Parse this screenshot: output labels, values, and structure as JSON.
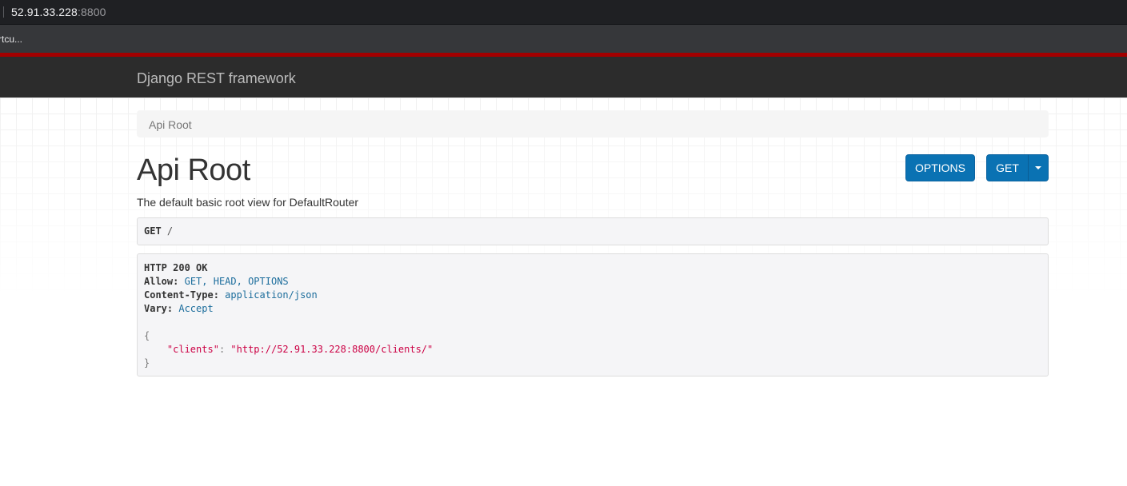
{
  "browser": {
    "url_host": "52.91.33.228",
    "url_port": ":8800",
    "bookmark_label": "rtcu..."
  },
  "navbar": {
    "brand": "Django REST framework"
  },
  "breadcrumb": {
    "items": [
      "Api Root"
    ]
  },
  "page": {
    "title": "Api Root",
    "description": "The default basic root view for DefaultRouter"
  },
  "buttons": {
    "options_label": "OPTIONS",
    "get_label": "GET"
  },
  "request": {
    "method": "GET",
    "path": "/"
  },
  "response": {
    "status": "HTTP 200 OK",
    "headers": [
      {
        "name": "Allow:",
        "value": "GET, HEAD, OPTIONS"
      },
      {
        "name": "Content-Type:",
        "value": "application/json"
      },
      {
        "name": "Vary:",
        "value": "Accept"
      }
    ],
    "open_brace": "{",
    "body_key": "\"clients\"",
    "body_sep": ": ",
    "body_value": "\"http://52.91.33.228:8800/clients/\"",
    "close_brace": "}"
  },
  "colors": {
    "navbar_accent": "#a30000",
    "button_primary": "#0a72b3",
    "header_value": "#1c6d9c",
    "json_string": "#cc0044"
  }
}
